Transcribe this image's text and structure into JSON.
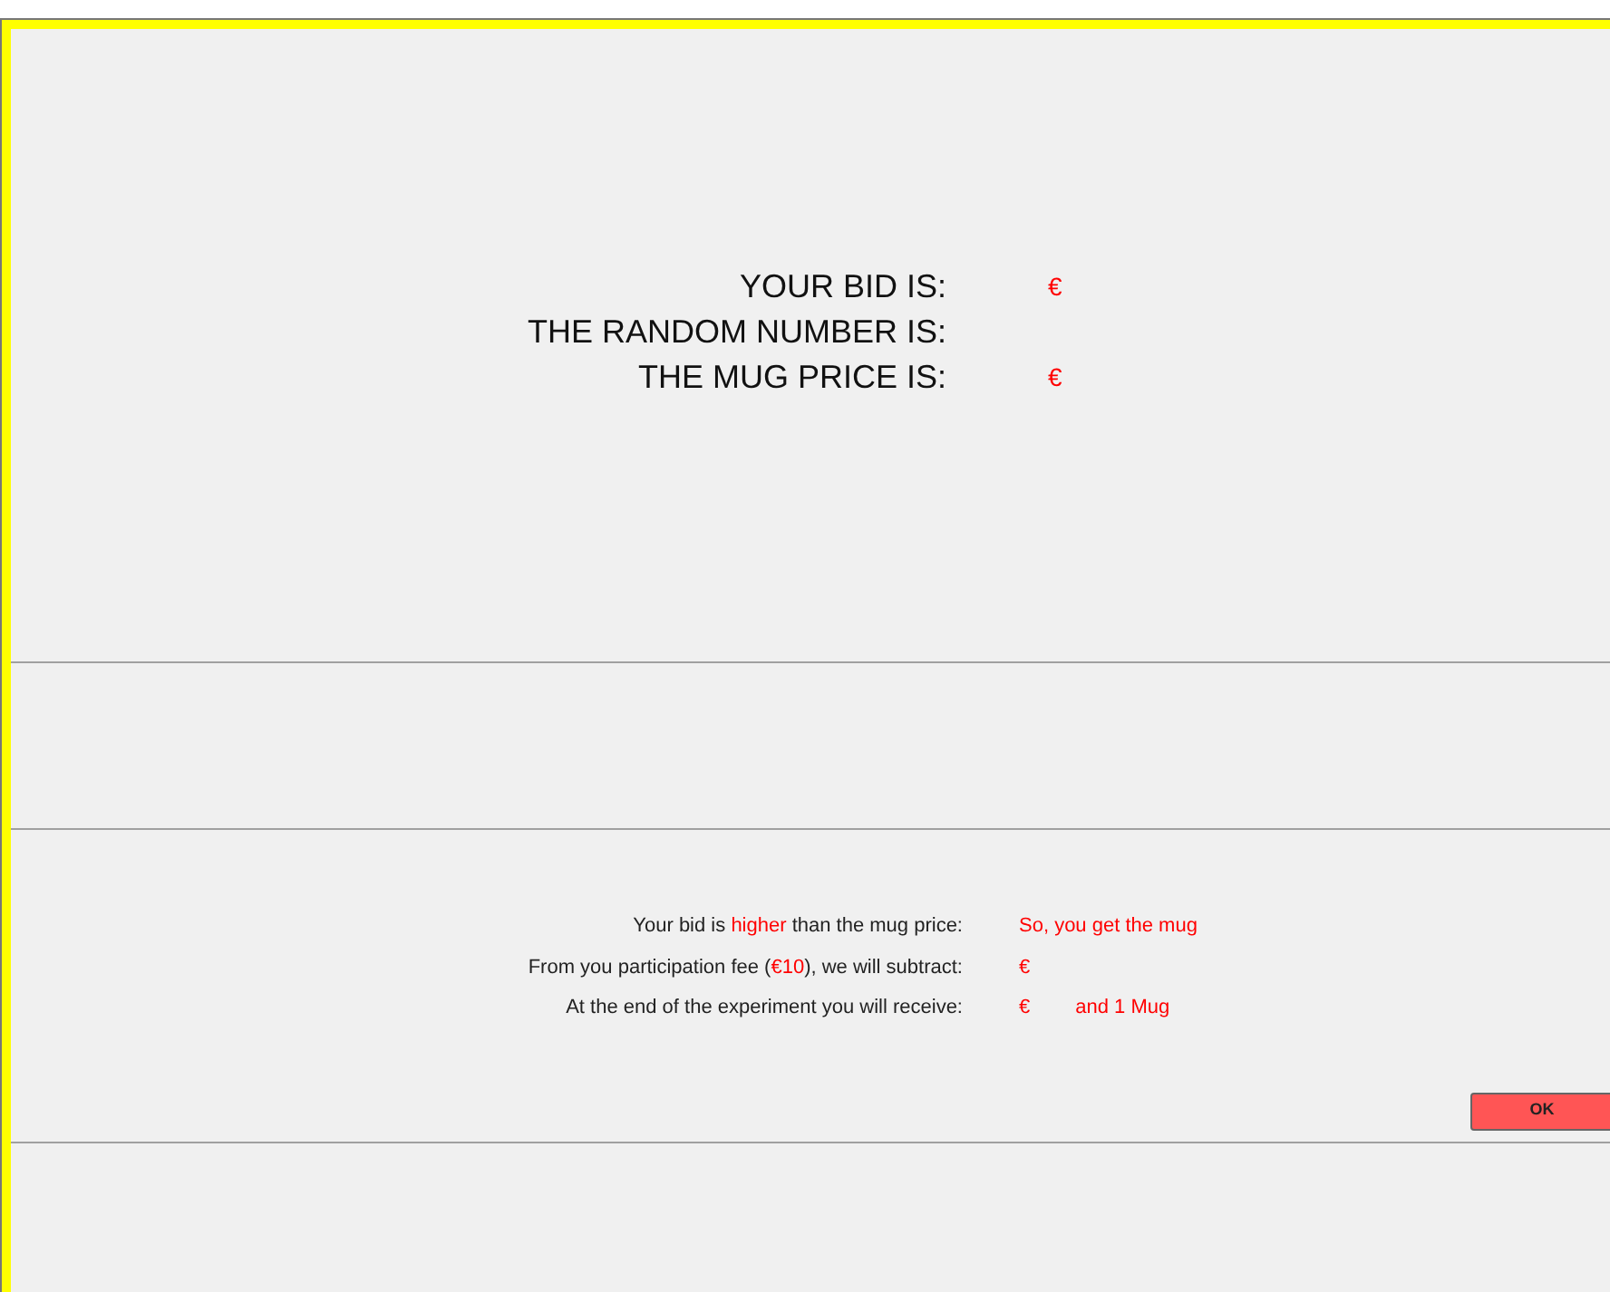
{
  "result_rows": [
    {
      "label": "YOUR BID IS:",
      "value": "€"
    },
    {
      "label": "THE RANDOM NUMBER IS:"
    },
    {
      "label": "THE MUG PRICE IS:",
      "value": "€"
    }
  ],
  "summary_rows": [
    {
      "label": [
        {
          "text": "Your bid is ",
          "highlight": false
        },
        {
          "text": "higher",
          "highlight": true
        },
        {
          "text": " than the mug price:",
          "highlight": false
        }
      ],
      "values": [
        "So, you get the mug"
      ]
    },
    {
      "label": [
        {
          "text": "From you participation fee (",
          "highlight": false
        },
        {
          "text": "€10",
          "highlight": true
        },
        {
          "text": "), we will subtract:",
          "highlight": false
        }
      ],
      "values": [
        "€"
      ]
    },
    {
      "label": [
        {
          "text": "At the end of the experiment you will receive:",
          "highlight": false
        }
      ],
      "values": [
        "€",
        "and 1 Mug"
      ]
    }
  ],
  "ok_button": "OK"
}
